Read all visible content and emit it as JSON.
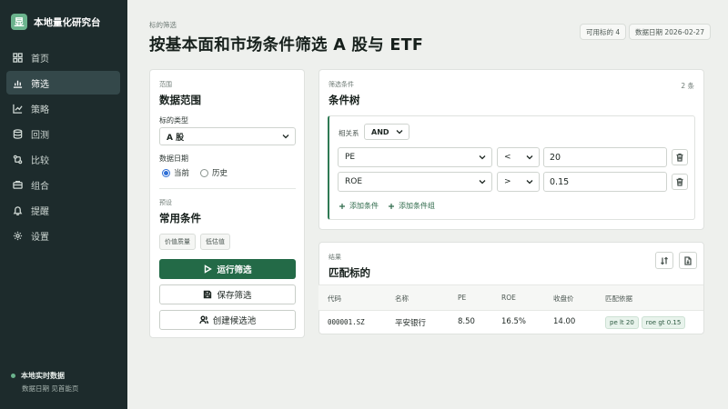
{
  "app": {
    "logo_char": "显",
    "name": "本地量化研究台"
  },
  "nav": [
    {
      "label": "首页",
      "icon": "grid-icon",
      "active": false
    },
    {
      "label": "筛选",
      "icon": "bar-chart-icon",
      "active": true
    },
    {
      "label": "策略",
      "icon": "line-chart-icon",
      "active": false
    },
    {
      "label": "回测",
      "icon": "database-icon",
      "active": false
    },
    {
      "label": "比较",
      "icon": "compare-icon",
      "active": false
    },
    {
      "label": "组合",
      "icon": "portfolio-icon",
      "active": false
    },
    {
      "label": "提醒",
      "icon": "bell-icon",
      "active": false
    },
    {
      "label": "设置",
      "icon": "gear-icon",
      "active": false
    }
  ],
  "status": {
    "title": "本地实时数据",
    "subtitle": "数据日期 见首能页",
    "color": "#6bb38d"
  },
  "header": {
    "crumb": "标的筛选",
    "title": "按基本面和市场条件筛选 A 股与 ETF",
    "available": "可用标的 4",
    "data_date": "数据日期 2026-02-27"
  },
  "scope": {
    "eyebrow": "范围",
    "title": "数据范围",
    "type_label": "标的类型",
    "type_value": "A 股",
    "date_label": "数据日期",
    "date_options": [
      "当前",
      "历史"
    ],
    "date_selected": 0
  },
  "presets": {
    "eyebrow": "预设",
    "title": "常用条件",
    "tags": [
      "价值质量",
      "低估值"
    ]
  },
  "actions": {
    "run": "运行筛选",
    "save": "保存筛选",
    "create_pool": "创建候选池"
  },
  "conditions": {
    "eyebrow": "筛选条件",
    "title": "条件树",
    "count": "2 条",
    "relation_label": "相关系",
    "relation_value": "AND",
    "rows": [
      {
        "field": "PE",
        "op": "<",
        "value": "20"
      },
      {
        "field": "ROE",
        "op": ">",
        "value": "0.15"
      }
    ],
    "add_condition": "添加条件",
    "add_group": "添加条件组"
  },
  "results": {
    "eyebrow": "结果",
    "title": "匹配标的",
    "columns": [
      "代码",
      "名称",
      "PE",
      "ROE",
      "收盘价",
      "匹配依据"
    ],
    "rows": [
      {
        "code": "000001.SZ",
        "name": "平安银行",
        "pe": "8.50",
        "roe": "16.5%",
        "close": "14.00",
        "matches": [
          "pe lt 20",
          "roe gt 0.15"
        ]
      }
    ]
  },
  "colors": {
    "sidebar": "#1d2b2c",
    "accent": "#236a47",
    "background": "#eef0ed"
  }
}
